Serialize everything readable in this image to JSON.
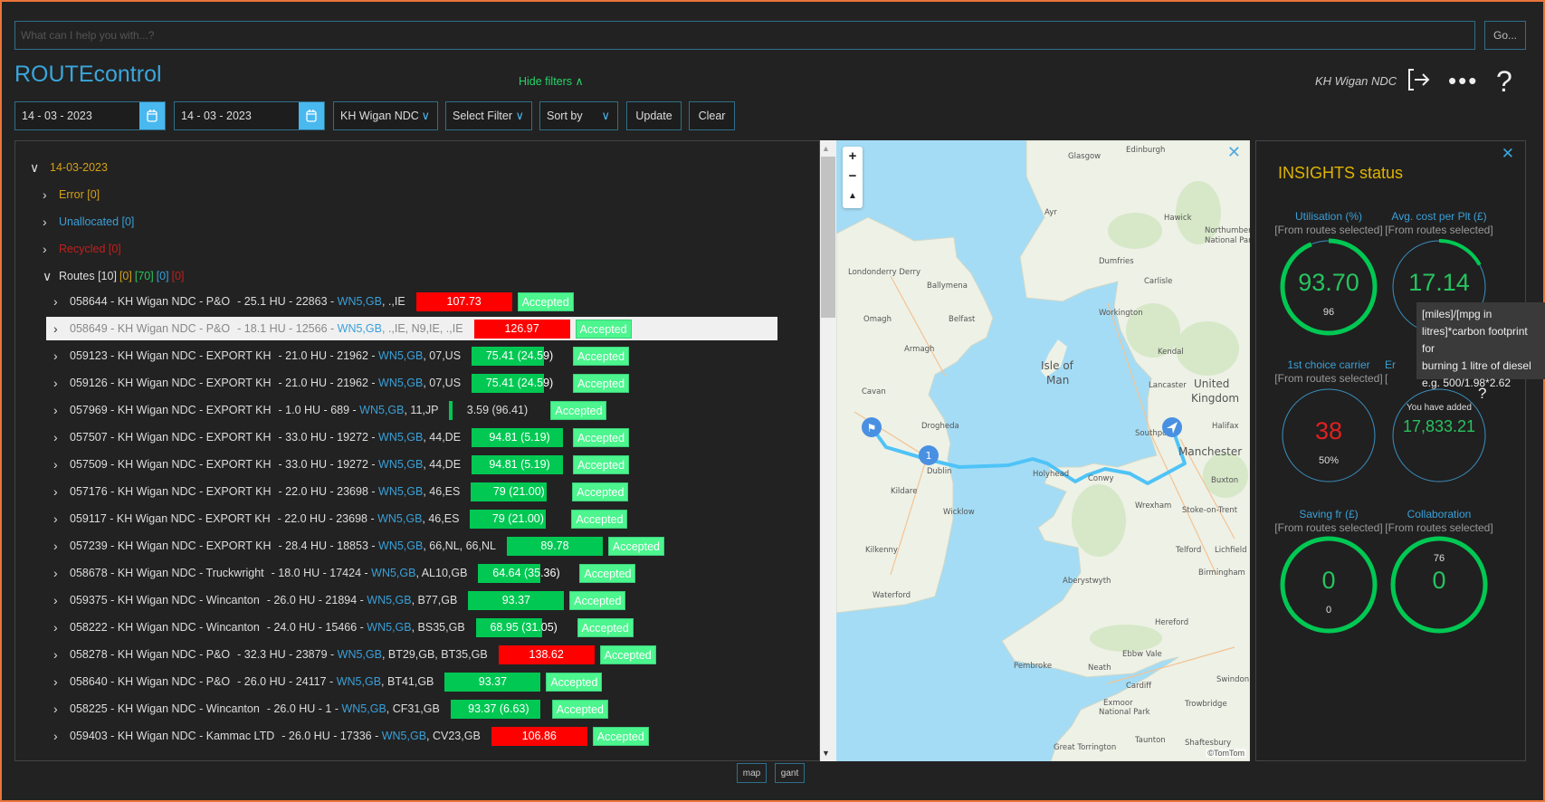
{
  "header": {
    "search_placeholder": "What can I help you with...?",
    "go_label": "Go...",
    "app_title": "ROUTEcontrol",
    "hide_filters": "Hide filters",
    "user": "KH Wigan NDC"
  },
  "filters": {
    "date_from": "14 - 03 - 2023",
    "date_to": "14 - 03 - 2023",
    "site": "KH Wigan NDC",
    "filter": "Select Filter",
    "sort": "Sort by",
    "update": "Update",
    "clear": "Clear"
  },
  "tree": {
    "date": "14-03-2023",
    "error": "Error [0]",
    "unallocated": "Unallocated [0]",
    "recycled": "Recycled [0]",
    "routes_label": "Routes [10]",
    "routes_counts": [
      {
        "t": "[0]",
        "c": "#d4a017"
      },
      {
        "t": "[70]",
        "c": "#27c35f"
      },
      {
        "t": "[0]",
        "c": "#3aa0d8"
      },
      {
        "t": "[0]",
        "c": "#c0201c"
      }
    ],
    "rows": [
      {
        "title": "058644 - KH Wigan NDC - P&O",
        "meta": "- 25.1 HU - 22863  -",
        "origin": "WN5,GB",
        "dest": ", .,IE",
        "score": "107.73",
        "fill": 100,
        "color": "#ff0000",
        "status": "Accepted"
      },
      {
        "title": "058649 - KH Wigan NDC - P&O",
        "meta": "- 18.1 HU - 12566  -",
        "origin": "WN5,GB",
        "dest": ", .,IE, N9,IE, .,IE",
        "score": "126.97",
        "fill": 100,
        "color": "#ff0000",
        "status": "Accepted",
        "selected": true
      },
      {
        "title": "059123 - KH Wigan NDC - EXPORT KH",
        "meta": "- 21.0 HU - 21962  -",
        "origin": "WN5,GB",
        "dest": ", 07,US",
        "score": "75.41 (24.59)",
        "fill": 75.41,
        "color": "#00c853",
        "status": "Accepted"
      },
      {
        "title": "059126 - KH Wigan NDC - EXPORT KH",
        "meta": "- 21.0 HU - 21962  -",
        "origin": "WN5,GB",
        "dest": ", 07,US",
        "score": "75.41 (24.59)",
        "fill": 75.41,
        "color": "#00c853",
        "status": "Accepted"
      },
      {
        "title": "057969 - KH Wigan NDC - EXPORT KH",
        "meta": "- 1.0 HU - 689  -",
        "origin": "WN5,GB",
        "dest": ", 11,JP",
        "score": "3.59 (96.41)",
        "fill": 3.59,
        "color": "#00c853",
        "status": "Accepted"
      },
      {
        "title": "057507 - KH Wigan NDC - EXPORT KH",
        "meta": "- 33.0 HU - 19272  -",
        "origin": "WN5,GB",
        "dest": ", 44,DE",
        "score": "94.81 (5.19)",
        "fill": 94.81,
        "color": "#00c853",
        "status": "Accepted"
      },
      {
        "title": "057509 - KH Wigan NDC - EXPORT KH",
        "meta": "- 33.0 HU - 19272  -",
        "origin": "WN5,GB",
        "dest": ", 44,DE",
        "score": "94.81 (5.19)",
        "fill": 94.81,
        "color": "#00c853",
        "status": "Accepted"
      },
      {
        "title": "057176 - KH Wigan NDC - EXPORT KH",
        "meta": "- 22.0 HU - 23698  -",
        "origin": "WN5,GB",
        "dest": ", 46,ES",
        "score": "79 (21.00)",
        "fill": 79,
        "color": "#00c853",
        "status": "Accepted"
      },
      {
        "title": "059117 - KH Wigan NDC - EXPORT KH",
        "meta": "- 22.0 HU - 23698  -",
        "origin": "WN5,GB",
        "dest": ", 46,ES",
        "score": "79 (21.00)",
        "fill": 79,
        "color": "#00c853",
        "status": "Accepted"
      },
      {
        "title": "057239 - KH Wigan NDC - EXPORT KH",
        "meta": "- 28.4 HU - 18853  -",
        "origin": "WN5,GB",
        "dest": ", 66,NL, 66,NL",
        "score": "89.78",
        "fill": 100,
        "color": "#00c853",
        "status": "Accepted"
      },
      {
        "title": "058678 - KH Wigan NDC - Truckwright",
        "meta": "- 18.0 HU - 17424  -",
        "origin": "WN5,GB",
        "dest": ", AL10,GB",
        "score": "64.64 (35.36)",
        "fill": 64.64,
        "color": "#00c853",
        "status": "Accepted"
      },
      {
        "title": "059375 - KH Wigan NDC - Wincanton",
        "meta": "- 26.0 HU - 21894  -",
        "origin": "WN5,GB",
        "dest": ", B77,GB",
        "score": "93.37",
        "fill": 100,
        "color": "#00c853",
        "status": "Accepted"
      },
      {
        "title": "058222 - KH Wigan NDC - Wincanton",
        "meta": "- 24.0 HU - 15466  -",
        "origin": "WN5,GB",
        "dest": ", BS35,GB",
        "score": "68.95 (31.05)",
        "fill": 68.95,
        "color": "#00c853",
        "status": "Accepted"
      },
      {
        "title": "058278 - KH Wigan NDC - P&O",
        "meta": "- 32.3 HU - 23879  -",
        "origin": "WN5,GB",
        "dest": ", BT29,GB, BT35,GB",
        "score": "138.62",
        "fill": 100,
        "color": "#ff0000",
        "status": "Accepted"
      },
      {
        "title": "058640 - KH Wigan NDC - P&O",
        "meta": "- 26.0 HU - 24117  -",
        "origin": "WN5,GB",
        "dest": ", BT41,GB",
        "score": "93.37",
        "fill": 100,
        "color": "#00c853",
        "status": "Accepted"
      },
      {
        "title": "058225 - KH Wigan NDC - Wincanton",
        "meta": "- 26.0 HU - 1  -",
        "origin": "WN5,GB",
        "dest": ", CF31,GB",
        "score": "93.37 (6.63)",
        "fill": 93.37,
        "color": "#00c853",
        "status": "Accepted"
      },
      {
        "title": "059403 - KH Wigan NDC - Kammac LTD",
        "meta": "- 26.0 HU - 17336  -",
        "origin": "WN5,GB",
        "dest": ", CV23,GB",
        "score": "106.86",
        "fill": 100,
        "color": "#ff0000",
        "status": "Accepted"
      }
    ]
  },
  "map": {
    "labels": [
      [
        "Glasgow",
        256,
        12
      ],
      [
        "Edinburgh",
        320,
        5
      ],
      [
        "Ayr",
        230,
        74
      ],
      [
        "Hawick",
        362,
        80
      ],
      [
        "Northumberland",
        407,
        94
      ],
      [
        "National Park",
        407,
        105
      ],
      [
        "Dumfries",
        290,
        128
      ],
      [
        "Carlisle",
        340,
        150
      ],
      [
        "Londonderry Derry",
        13,
        140
      ],
      [
        "Ballymena",
        100,
        155
      ],
      [
        "Belfast",
        124,
        192
      ],
      [
        "Omagh",
        30,
        192
      ],
      [
        "Armagh",
        75,
        225
      ],
      [
        "Workington",
        290,
        185
      ],
      [
        "Kendal",
        355,
        228
      ],
      [
        "Isle of",
        226,
        245
      ],
      [
        "Man",
        232,
        261
      ],
      [
        "Lancaster",
        345,
        265
      ],
      [
        "United",
        395,
        265
      ],
      [
        "Kingdom",
        392,
        281
      ],
      [
        "Cavan",
        28,
        272
      ],
      [
        "Drogheda",
        94,
        310
      ],
      [
        "Southport",
        330,
        318
      ],
      [
        "Halifax",
        415,
        310
      ],
      [
        "Manchester",
        378,
        340
      ],
      [
        "Dublin",
        100,
        360
      ],
      [
        "Holyhead",
        217,
        363
      ],
      [
        "Conwy",
        278,
        368
      ],
      [
        "Kildare",
        60,
        382
      ],
      [
        "Wicklow",
        118,
        405
      ],
      [
        "Wrexham",
        330,
        398
      ],
      [
        "Stoke-on-Trent",
        382,
        403
      ],
      [
        "Buxton",
        414,
        370
      ],
      [
        "Kilkenny",
        32,
        447
      ],
      [
        "Telford",
        375,
        447
      ],
      [
        "Lichfield",
        418,
        447
      ],
      [
        "Aberystwyth",
        250,
        481
      ],
      [
        "Birmingham",
        400,
        472
      ],
      [
        "Waterford",
        40,
        497
      ],
      [
        "Hereford",
        352,
        527
      ],
      [
        "Ebbw Vale",
        316,
        562
      ],
      [
        "Pembroke",
        196,
        575
      ],
      [
        "Neath",
        278,
        577
      ],
      [
        "Swindon",
        420,
        590
      ],
      [
        "Cardiff",
        320,
        597
      ],
      [
        "Exmoor",
        295,
        616
      ],
      [
        "National Park",
        290,
        626
      ],
      [
        "Trowbridge",
        385,
        617
      ],
      [
        "Taunton",
        330,
        657
      ],
      [
        "Shaftesbury",
        385,
        660
      ],
      [
        "Great Torrington",
        240,
        665
      ]
    ],
    "attribution": "©TomTom",
    "cluster_count": "1"
  },
  "insights": {
    "title": "INSIGHTS status",
    "tooltip": [
      "[miles]/[mpg in",
      "litres]*carbon footprint for",
      "burning 1 litre of diesel",
      "e.g. 500/1.98*2.62"
    ],
    "help": "?",
    "utilisation": {
      "label": "Utilisation (%)",
      "sub": "[From routes selected]",
      "value": "93.70",
      "secondary": "96",
      "progress": 0.937
    },
    "avg_cost": {
      "label": "Avg. cost per Plt (£)",
      "sub": "[From routes selected]",
      "value": "17.14",
      "progress": 0.17
    },
    "first_choice": {
      "label": "1st choice carrier",
      "sub": "[From routes selected]",
      "value": "38",
      "secondary": "50%"
    },
    "emissions": {
      "label": "Er",
      "sub": "[",
      "caption": "You have added",
      "value": "17,833.21"
    },
    "saving": {
      "label": "Saving fr (£)",
      "sub": "[From routes selected]",
      "value": "0",
      "secondary": "0"
    },
    "collaboration": {
      "label": "Collaboration",
      "sub": "[From routes selected]",
      "value": "0",
      "secondary": "76"
    }
  },
  "bottom": {
    "map": "map",
    "gant": "gant"
  },
  "colors": {
    "accent": "#3aa6dc",
    "green": "#00c853",
    "red": "#ff0000",
    "gold": "#e0b400",
    "border": "#e8743b"
  }
}
